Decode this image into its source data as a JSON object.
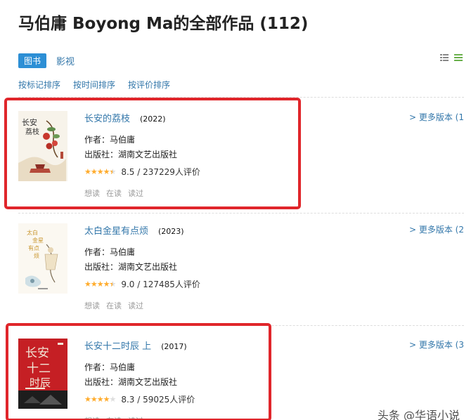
{
  "page": {
    "title": "马伯庸 Boyong Ma的全部作品 (112)"
  },
  "tabs": [
    {
      "label": "图书",
      "active": true
    },
    {
      "label": "影视",
      "active": false
    }
  ],
  "view_icons": [
    "list-view-icon",
    "grid-view-icon"
  ],
  "sorts": [
    "按标记排序",
    "按时间排序",
    "按评价排序"
  ],
  "colors": {
    "link": "#3377aa",
    "tab_active": "#2d8fd5",
    "star": "#ffac2d",
    "highlight": "#e0262b"
  },
  "books": [
    {
      "title": "长安的荔枝",
      "year": "(2022)",
      "author": "作者：马伯庸",
      "publisher": "出版社：湖南文艺出版社",
      "rating": "8.5 / 237229人评价",
      "star_level": 4.5,
      "actions": [
        "想读",
        "在读",
        "读过"
      ],
      "versions": "> 更多版本 (1"
    },
    {
      "title": "太白金星有点烦",
      "year": "(2023)",
      "author": "作者：马伯庸",
      "publisher": "出版社：湖南文艺出版社",
      "rating": "9.0 / 127485人评价",
      "star_level": 4.5,
      "actions": [
        "想读",
        "在读",
        "读过"
      ],
      "versions": "> 更多版本 (2"
    },
    {
      "title": "长安十二时辰 上",
      "year": "(2017)",
      "author": "作者：马伯庸",
      "publisher": "出版社：湖南文艺出版社",
      "rating": "8.3 / 59025人评价",
      "star_level": 4,
      "actions": [
        "想读",
        "在读",
        "读过"
      ],
      "versions": "> 更多版本 (3"
    }
  ],
  "watermark": "头条 @华语小说"
}
